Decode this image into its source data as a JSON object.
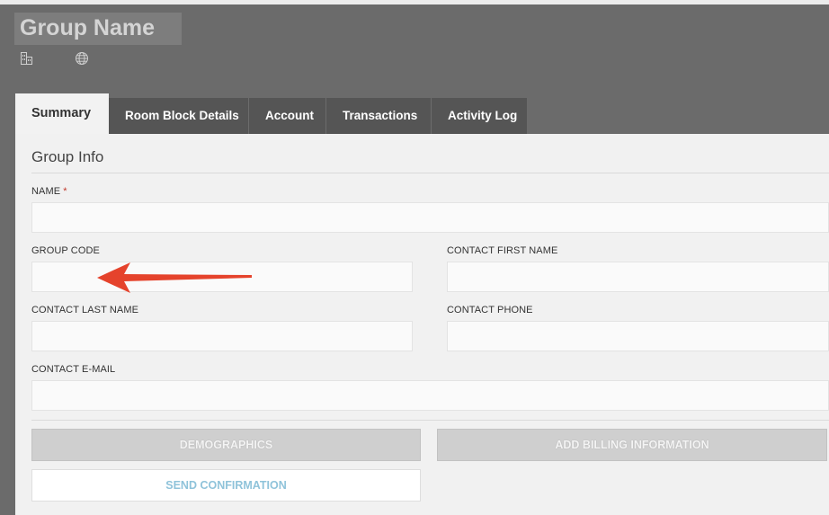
{
  "header": {
    "group_name": "Group Name",
    "icons": [
      "building-icon",
      "globe-icon"
    ]
  },
  "tabs": [
    {
      "label": "Summary",
      "active": true
    },
    {
      "label": "Room Block Details",
      "active": false
    },
    {
      "label": "Account",
      "active": false
    },
    {
      "label": "Transactions",
      "active": false
    },
    {
      "label": "Activity Log",
      "active": false
    }
  ],
  "section": {
    "title": "Group Info"
  },
  "fields": {
    "name": {
      "label": "NAME",
      "required_mark": "*",
      "value": ""
    },
    "group_code": {
      "label": "GROUP CODE",
      "value": ""
    },
    "contact_first_name": {
      "label": "CONTACT FIRST NAME",
      "value": ""
    },
    "contact_last_name": {
      "label": "CONTACT LAST NAME",
      "value": ""
    },
    "contact_phone": {
      "label": "CONTACT PHONE",
      "value": ""
    },
    "contact_email": {
      "label": "CONTACT E-MAIL",
      "value": ""
    }
  },
  "buttons": {
    "demographics": "DEMOGRAPHICS",
    "add_billing": "ADD BILLING INFORMATION",
    "send_confirmation": "SEND CONFIRMATION"
  },
  "colors": {
    "header_bg": "#6b6b6b",
    "tab_bg": "#555555",
    "panel_bg": "#f1f1f1",
    "required": "#c0392b",
    "annotation_arrow": "#e5432c",
    "link_text": "#8fc3da"
  }
}
